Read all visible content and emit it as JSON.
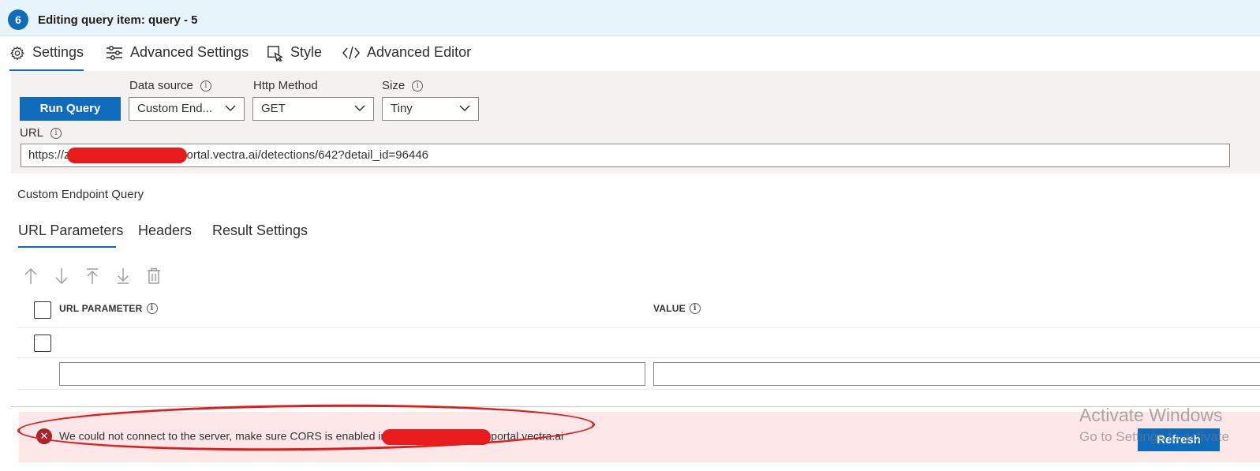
{
  "header": {
    "step_number": "6",
    "title": "Editing query item: query - 5"
  },
  "tabs": [
    {
      "label": "Settings",
      "icon": "gear-icon",
      "active": true
    },
    {
      "label": "Advanced Settings",
      "icon": "sliders-icon",
      "active": false
    },
    {
      "label": "Style",
      "icon": "paint-icon",
      "active": false
    },
    {
      "label": "Advanced Editor",
      "icon": "code-icon",
      "active": false
    }
  ],
  "settings": {
    "run_query_label": "Run Query",
    "data_source_label": "Data source",
    "data_source_value": "Custom End...",
    "http_method_label": "Http Method",
    "http_method_value": "GET",
    "size_label": "Size",
    "size_value": "Tiny",
    "url_label": "URL",
    "url_prefix": "https://z",
    "url_suffix": "ortal.vectra.ai/detections/642?detail_id=96446"
  },
  "section_title": "Custom Endpoint Query",
  "subtabs": [
    {
      "label": "URL Parameters",
      "active": true
    },
    {
      "label": "Headers",
      "active": false
    },
    {
      "label": "Result Settings",
      "active": false
    }
  ],
  "grid": {
    "col_param": "URL PARAMETER",
    "col_value": "VALUE"
  },
  "error": {
    "text_prefix": "We could not connect to the server, make sure CORS is enabled in",
    "text_suffix": "portal.vectra.ai"
  },
  "refresh_label": "Refresh",
  "watermark": {
    "line1": "Activate Windows",
    "line2": "Go to Settings to activate"
  },
  "colors": {
    "accent": "#0f6cbd",
    "header_bg": "#e8f4fc",
    "error_bg": "#fde7e9",
    "error_icon": "#a4262c",
    "annotation_red": "#e21b1b"
  }
}
